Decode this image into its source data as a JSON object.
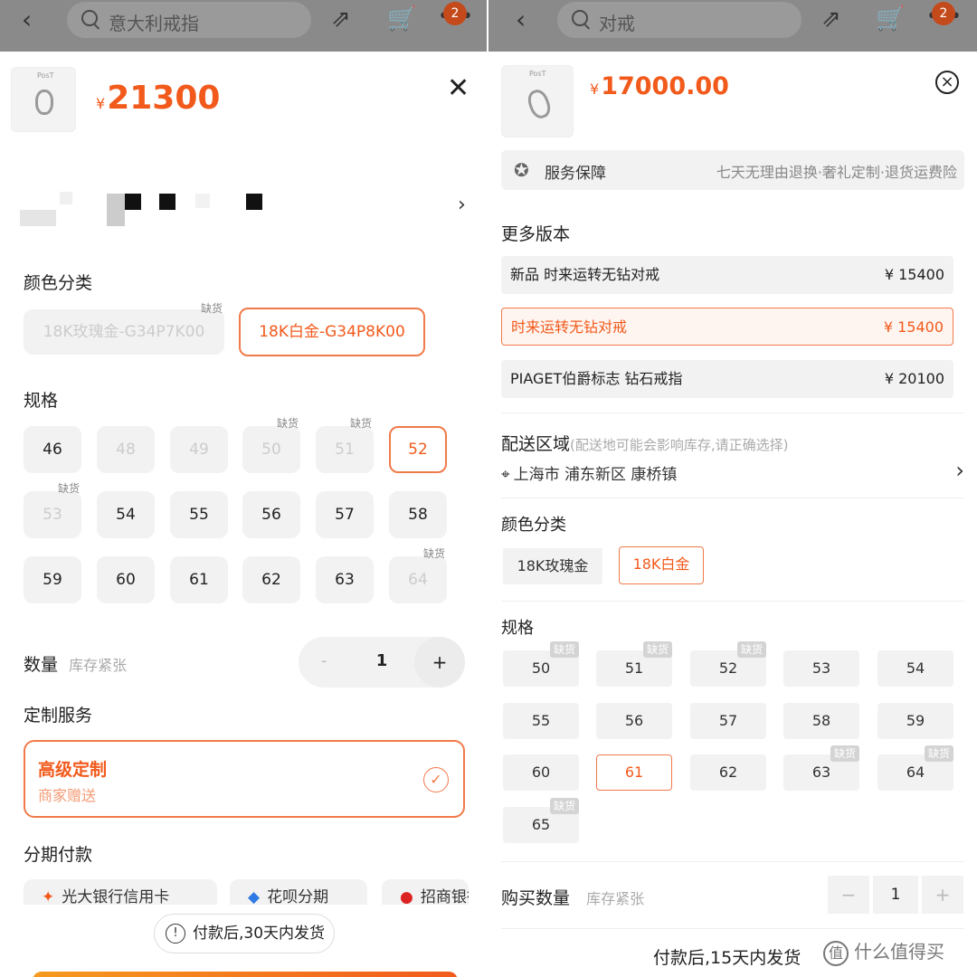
{
  "left": {
    "search_text": "意大利戒指",
    "cart_badge": "2",
    "thumb_label": "PosT",
    "price_symbol": "¥",
    "price": "21300",
    "color_title": "颜色分类",
    "colors": [
      {
        "label": "18K玫瑰金-G34P7K00",
        "tag": "缺货"
      },
      {
        "label": "18K白金-G34P8K00",
        "tag": ""
      }
    ],
    "size_title": "规格",
    "sizes": [
      {
        "v": "46",
        "tag": ""
      },
      {
        "v": "48",
        "tag": ""
      },
      {
        "v": "49",
        "tag": ""
      },
      {
        "v": "50",
        "tag": "缺货"
      },
      {
        "v": "51",
        "tag": "缺货"
      },
      {
        "v": "52",
        "tag": ""
      },
      {
        "v": "53",
        "tag": "缺货"
      },
      {
        "v": "54",
        "tag": ""
      },
      {
        "v": "55",
        "tag": ""
      },
      {
        "v": "56",
        "tag": ""
      },
      {
        "v": "57",
        "tag": ""
      },
      {
        "v": "58",
        "tag": ""
      },
      {
        "v": "59",
        "tag": ""
      },
      {
        "v": "60",
        "tag": ""
      },
      {
        "v": "61",
        "tag": ""
      },
      {
        "v": "62",
        "tag": ""
      },
      {
        "v": "63",
        "tag": ""
      },
      {
        "v": "64",
        "tag": "缺货"
      }
    ],
    "qty_title": "数量",
    "qty_hint": "库存紧张",
    "qty_minus": "-",
    "qty_value": "1",
    "qty_plus": "+",
    "service_title": "定制服务",
    "service_name": "高级定制",
    "service_sub": "商家赠送",
    "service_check": "✓",
    "installment_title": "分期付款",
    "installments": [
      "光大银行信用卡",
      "花呗分期",
      "招商银行"
    ],
    "ship_notice": "付款后,30天内发货",
    "ship_icon": "!"
  },
  "right": {
    "search_text": "对戒",
    "cart_badge": "2",
    "thumb_label": "PosT",
    "price_symbol": "¥",
    "price": "17000.00",
    "close_icon": "×",
    "guarantee_title": "服务保障",
    "guarantee_desc": "七天无理由退换·奢礼定制·退货运费险",
    "versions_title": "更多版本",
    "versions": [
      {
        "label": "新品 时来运转无钻对戒",
        "price": "¥ 15400"
      },
      {
        "label": "时来运转无钻对戒",
        "price": "¥ 15400"
      },
      {
        "label": "PIAGET伯爵标志 钻石戒指",
        "price": "¥ 20100"
      }
    ],
    "delivery_title": "配送区域",
    "delivery_hint": "(配送地可能会影响库存,请正确选择)",
    "delivery_address": "上海市 浦东新区 康桥镇",
    "color_title": "颜色分类",
    "colors": [
      "18K玫瑰金",
      "18K白金"
    ],
    "size_title": "规格",
    "sizes": [
      {
        "v": "50",
        "tag": "缺货"
      },
      {
        "v": "51",
        "tag": "缺货"
      },
      {
        "v": "52",
        "tag": "缺货"
      },
      {
        "v": "53",
        "tag": ""
      },
      {
        "v": "54",
        "tag": ""
      },
      {
        "v": "55",
        "tag": ""
      },
      {
        "v": "56",
        "tag": ""
      },
      {
        "v": "57",
        "tag": ""
      },
      {
        "v": "58",
        "tag": ""
      },
      {
        "v": "59",
        "tag": ""
      },
      {
        "v": "60",
        "tag": ""
      },
      {
        "v": "61",
        "tag": ""
      },
      {
        "v": "62",
        "tag": ""
      },
      {
        "v": "63",
        "tag": "缺货"
      },
      {
        "v": "64",
        "tag": "缺货"
      },
      {
        "v": "65",
        "tag": "缺货"
      }
    ],
    "qty_title": "购买数量",
    "qty_hint": "库存紧张",
    "qty_minus": "−",
    "qty_value": "1",
    "qty_plus": "+",
    "ship_notice": "付款后,15天内发货",
    "watermark": "什么值得买",
    "watermark_icon": "值"
  },
  "colors": {
    "accent": "#f25a1c",
    "accent_border": "#f07a4a",
    "topbar": "#8a8a8a",
    "chip_bg": "#f2f2f2"
  },
  "icons": {
    "back": "chevron-left-icon",
    "share": "share-icon",
    "cart": "cart-icon",
    "message": "message-icon",
    "close": "close-icon",
    "location": "location-pin-icon",
    "guarantee": "medal-icon",
    "chevron": "chevron-right-icon"
  }
}
